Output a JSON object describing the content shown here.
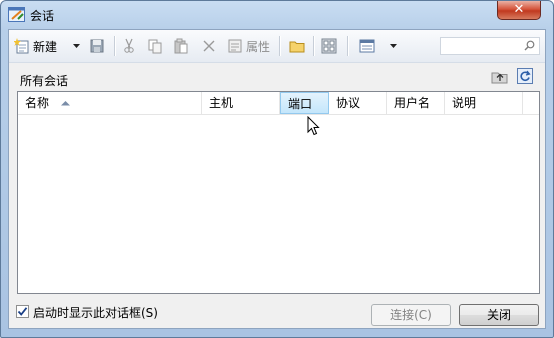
{
  "window": {
    "title": "会话"
  },
  "toolbar": {
    "new_label": "新建",
    "properties_label": "属性",
    "search": {
      "value": ""
    }
  },
  "panel": {
    "label": "所有会话"
  },
  "table": {
    "columns": [
      {
        "label": "名称",
        "sorted": true
      },
      {
        "label": "主机"
      },
      {
        "label": "端口",
        "hot": true
      },
      {
        "label": "协议"
      },
      {
        "label": "用户名"
      },
      {
        "label": "说明"
      }
    ],
    "rows": []
  },
  "footer": {
    "startup_checkbox_label": "启动时显示此对话框(S)",
    "startup_checked": true,
    "connect_label": "连接(C)",
    "close_label": "关闭"
  },
  "colors": {
    "accent": "#3399ff",
    "header_hot": "#c4e6fb",
    "close": "#c7432a"
  }
}
